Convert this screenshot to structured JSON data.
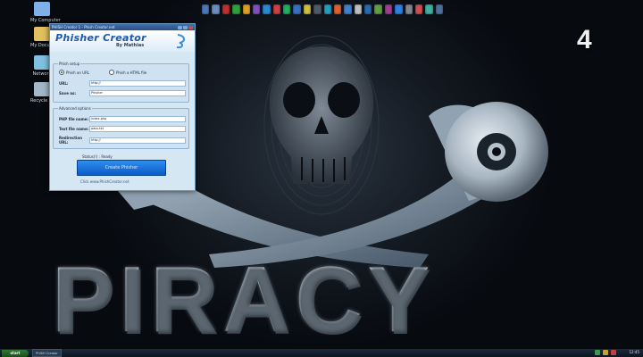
{
  "desktop": {
    "icons": [
      {
        "label": "My Computer",
        "icon": "computer-icon",
        "color": "#7fb0e8"
      },
      {
        "label": "My Documents",
        "icon": "folder-icon",
        "color": "#e0c060"
      },
      {
        "label": "Network",
        "icon": "network-icon",
        "color": "#80c0e0"
      },
      {
        "label": "Recycle Bin",
        "icon": "trash-icon",
        "color": "#a0b8c8"
      }
    ],
    "quick_launch_colors": [
      "#4a78b8",
      "#6a8fc0",
      "#c03030",
      "#30a040",
      "#e0a020",
      "#8050c0",
      "#2a8ad0",
      "#d04040",
      "#20b060",
      "#3a70c0",
      "#d0c040",
      "#505a6a",
      "#20a0c0",
      "#e06030",
      "#4080d0",
      "#c0c0c0",
      "#2a6ab0",
      "#60a040",
      "#a04090",
      "#3080e0",
      "#808890",
      "#d05050",
      "#40b0a0",
      "#5070a0"
    ]
  },
  "channel_logo": "4",
  "title_text": "PIRACY",
  "app": {
    "window_title": "PHISH Creator 1 - Phish Creator.net",
    "brand_name": "Phisher Creator",
    "brand_by": "By Mathias",
    "group1": {
      "label": "Phish setup",
      "radio_1": "Phish an URL",
      "radio_2": "Phish a HTML file",
      "url_label": "URL:",
      "url_value": "http://",
      "save_label": "Save as:",
      "save_value": "Phisher"
    },
    "group2": {
      "label": "Advanced options",
      "php_label": "PHP file name:",
      "php_value": "index.php",
      "text_label": "Text file name:",
      "text_value": "pass.txt",
      "redirect_label": "Redirection URL:",
      "redirect_value": "http://"
    },
    "status": "Status(!) : Ready",
    "create_button": "Create Phisher",
    "footer_link": "Click www.PhishCreator.net"
  },
  "taskbar": {
    "start_label": "start",
    "task_label": "PHISH Creator",
    "clock": "12:45"
  }
}
